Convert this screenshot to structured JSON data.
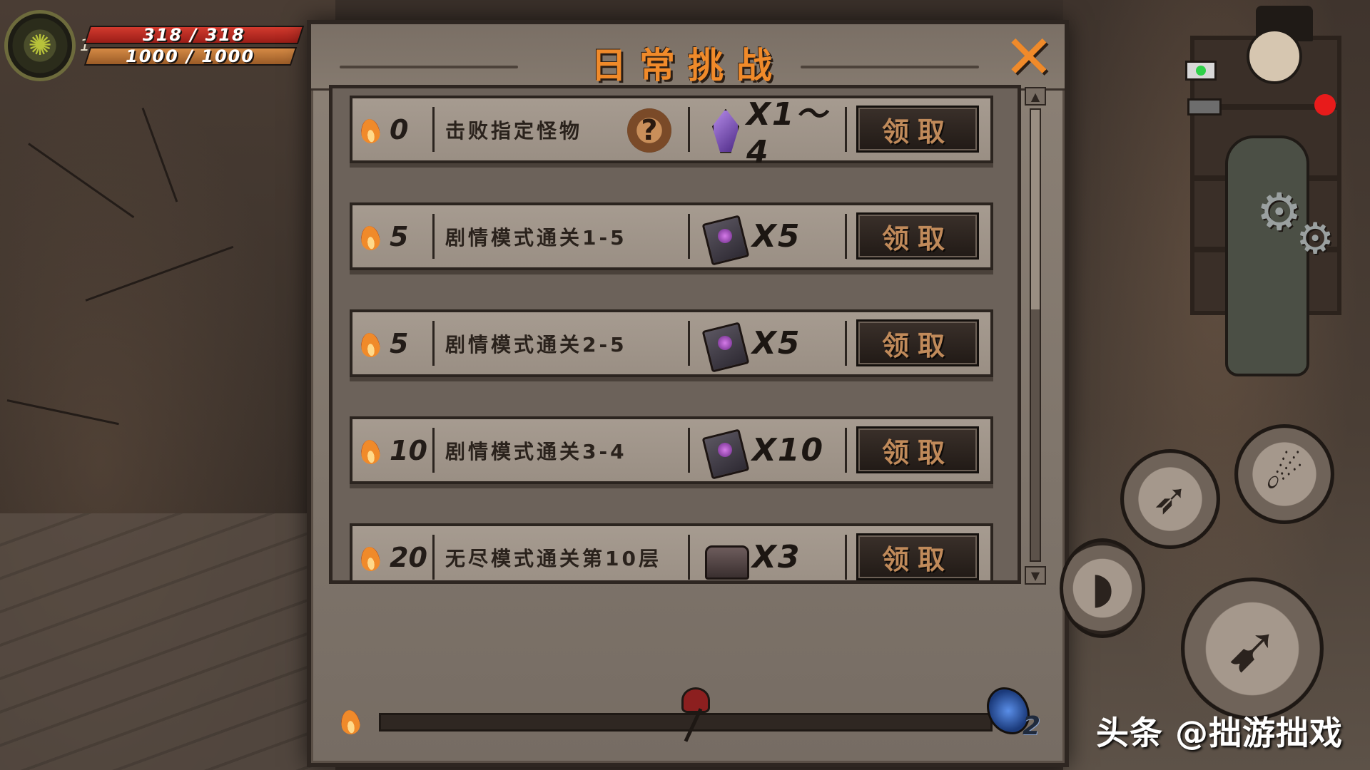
{
  "hud": {
    "level": "1",
    "hp": "318 / 318",
    "mp": "1000 / 1000"
  },
  "modal": {
    "title": "日常挑战",
    "close_icon": "close-icon",
    "tasks": [
      {
        "cost": "0",
        "desc": "击败指定怪物",
        "has_mystery": true,
        "reward_icon": "crystal-icon",
        "reward_qty": "X1～4",
        "claim_label": "领取"
      },
      {
        "cost": "5",
        "desc": "剧情模式通关1-5",
        "has_mystery": false,
        "reward_icon": "book-icon",
        "reward_qty": "X5",
        "claim_label": "领取"
      },
      {
        "cost": "5",
        "desc": "剧情模式通关2-5",
        "has_mystery": false,
        "reward_icon": "book-icon",
        "reward_qty": "X5",
        "claim_label": "领取"
      },
      {
        "cost": "10",
        "desc": "剧情模式通关3-4",
        "has_mystery": false,
        "reward_icon": "book-icon",
        "reward_qty": "X10",
        "claim_label": "领取"
      },
      {
        "cost": "20",
        "desc": "无尽模式通关第10层",
        "has_mystery": false,
        "reward_icon": "chest-icon",
        "reward_qty": "X3",
        "claim_label": "领取"
      }
    ],
    "progress": {
      "fraction": 0,
      "relic_count": "2"
    }
  },
  "colors": {
    "accent": "#f08a2a",
    "hp": "#d23a2e",
    "mp": "#d58a45",
    "panel": "#8c8176"
  },
  "watermark": "头条 @拙游拙戏"
}
